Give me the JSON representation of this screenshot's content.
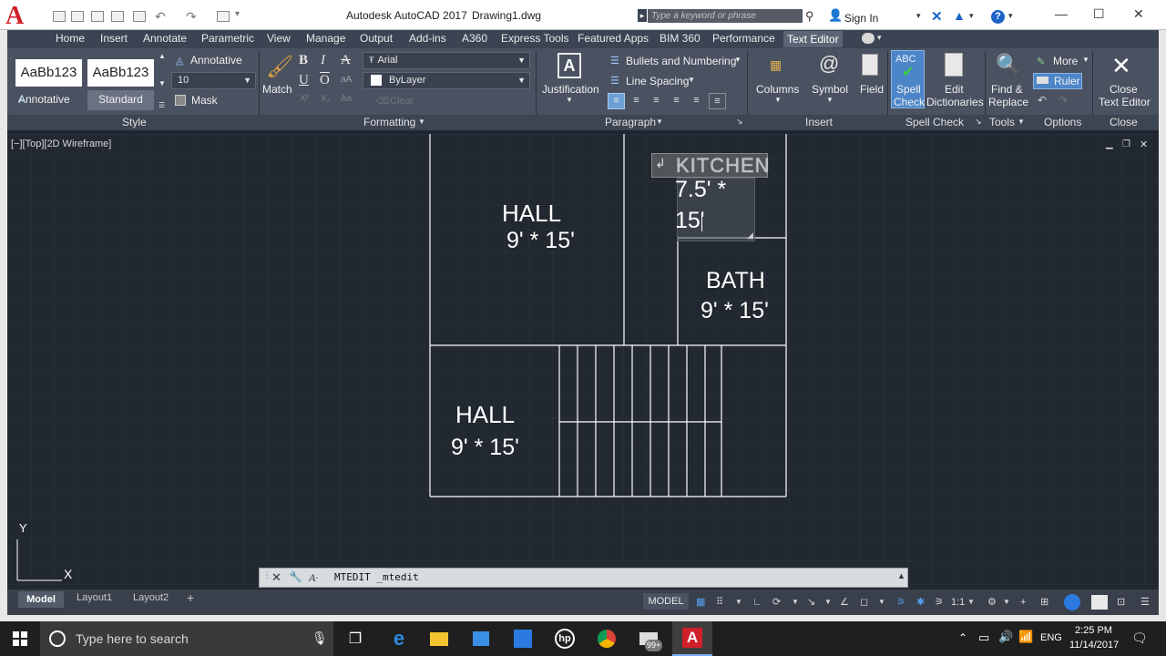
{
  "window": {
    "app_title": "Autodesk AutoCAD 2017",
    "doc_title": "Drawing1.dwg",
    "search_placeholder": "Type a keyword or phrase",
    "sign_in": "Sign In",
    "minimize": "—",
    "maximize": "☐",
    "close": "✕",
    "logo_letter": "A"
  },
  "ribbon_tabs": [
    "Home",
    "Insert",
    "Annotate",
    "Parametric",
    "View",
    "Manage",
    "Output",
    "Add-ins",
    "A360",
    "Express Tools",
    "Featured Apps",
    "BIM 360",
    "Performance",
    "Text Editor"
  ],
  "ribbon": {
    "style": {
      "sample1": "AaBb123",
      "sample2": "AaBb123",
      "label1": "Annotative",
      "label2": "Standard",
      "annotative": "Annotative",
      "height": "10",
      "mask": "Mask",
      "group": "Style"
    },
    "formatting": {
      "match": "Match",
      "bold": "B",
      "italic": "I",
      "strike": "A",
      "underline": "U",
      "overline": "O",
      "font": "Arial",
      "color": "ByLayer",
      "clear": "Clear",
      "group": "Formatting"
    },
    "paragraph": {
      "justification": "Justification",
      "bullets": "Bullets and Numbering",
      "line_spacing": "Line Spacing",
      "group": "Paragraph"
    },
    "insert": {
      "columns": "Columns",
      "symbol": "Symbol",
      "field": "Field",
      "group": "Insert"
    },
    "spell": {
      "abc": "ABC",
      "spell_check_l1": "Spell",
      "spell_check_l2": "Check",
      "edit_dict_l1": "Edit",
      "edit_dict_l2": "Dictionaries",
      "group": "Spell Check"
    },
    "tools": {
      "find_l1": "Find &",
      "find_l2": "Replace",
      "group": "Tools"
    },
    "options": {
      "more": "More",
      "ruler": "Ruler",
      "group": "Options"
    },
    "close": {
      "close_l1": "Close",
      "close_l2": "Text Editor",
      "group": "Close"
    }
  },
  "viewport_label": "[−][Top][2D Wireframe]",
  "drawing": {
    "rooms": [
      {
        "name": "HALL",
        "dims": "9' * 15'"
      },
      {
        "name": "BATH",
        "dims": "9' * 15'"
      },
      {
        "name": "HALL",
        "dims": "9' * 15'"
      }
    ],
    "mtext_header": "KITCHEN",
    "mtext_line1": "7.5' *",
    "mtext_line2": "15'",
    "ucs_x": "X",
    "ucs_y": "Y"
  },
  "command_line": "MTEDIT _mtedit",
  "layout_tabs": [
    "Model",
    "Layout1",
    "Layout2"
  ],
  "status": {
    "model": "MODEL",
    "scale": "1:1"
  },
  "taskbar": {
    "search_placeholder": "Type here to search",
    "badge": "99+",
    "lang": "ENG",
    "time": "2:25 PM",
    "date": "11/14/2017"
  }
}
